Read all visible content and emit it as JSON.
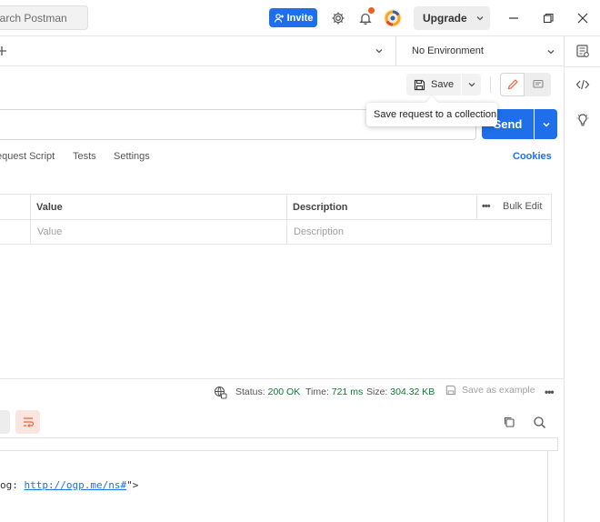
{
  "header": {
    "search_placeholder": "earch Postman",
    "invite_label": "Invite",
    "upgrade_label": "Upgrade"
  },
  "environment": {
    "selected": "No Environment"
  },
  "toolbar": {
    "save_label": "Save",
    "save_tooltip": "Save request to a collection",
    "send_label": "Send"
  },
  "request_tabs": [
    {
      "label": "equest Script"
    },
    {
      "label": "Tests"
    },
    {
      "label": "Settings"
    }
  ],
  "cookies_label": "Cookies",
  "params_table": {
    "columns": [
      "Value",
      "Description"
    ],
    "placeholders": [
      "Value",
      "Description"
    ],
    "bulk_edit_label": "Bulk Edit"
  },
  "response": {
    "status_label": "Status:",
    "status_value": "200 OK",
    "time_label": "Time:",
    "time_value": "721 ms",
    "size_label": "Size:",
    "size_value": "304.32 KB",
    "save_example_label": "Save as example",
    "code_prefix": "og: ",
    "code_link": "http://ogp.me/ns#",
    "code_suffix": "\">"
  },
  "colors": {
    "primary": "#1f6feb",
    "status_green": "#0a7d32",
    "notification": "#f25c1e"
  }
}
